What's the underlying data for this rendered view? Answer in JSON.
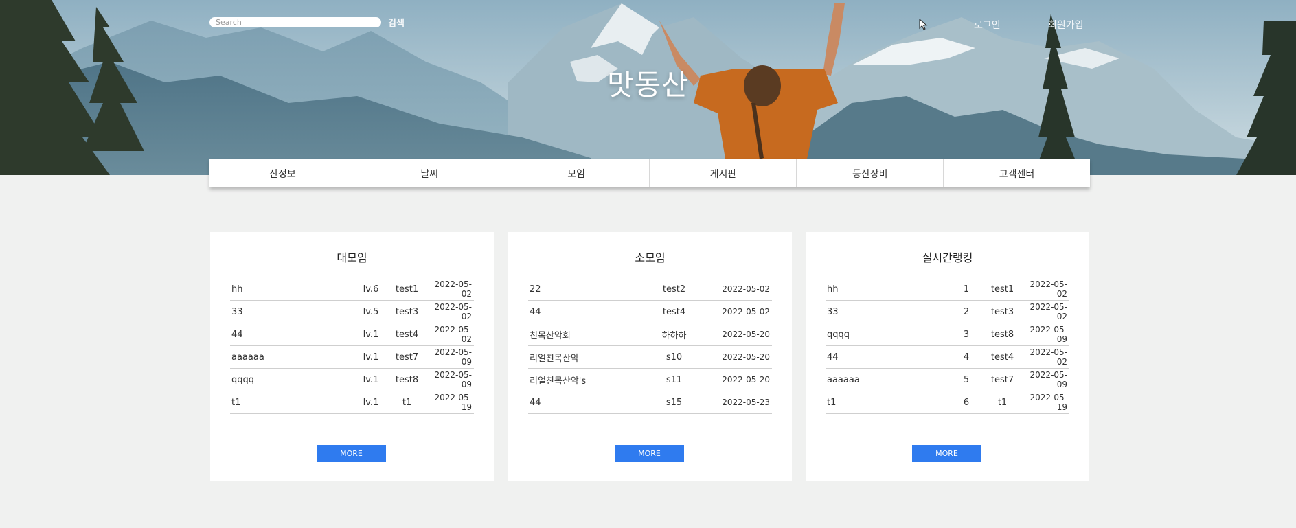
{
  "header": {
    "search_placeholder": "Search",
    "search_button": "검색",
    "login": "로그인",
    "signup": "회원가입",
    "site_title": "맛동산"
  },
  "nav": [
    "산정보",
    "날씨",
    "모임",
    "게시판",
    "등산장비",
    "고객센터"
  ],
  "colors": {
    "accent": "#2f7bef",
    "background": "#f0f1f0",
    "panel": "#ffffff"
  },
  "boards": [
    {
      "title": "대모임",
      "more": "MORE",
      "rows": [
        {
          "title": "hh",
          "mid": "lv.6",
          "user": "test1",
          "date": "2022-05-02"
        },
        {
          "title": "33",
          "mid": "lv.5",
          "user": "test3",
          "date": "2022-05-02"
        },
        {
          "title": "44",
          "mid": "lv.1",
          "user": "test4",
          "date": "2022-05-02"
        },
        {
          "title": "aaaaaa",
          "mid": "lv.1",
          "user": "test7",
          "date": "2022-05-09"
        },
        {
          "title": "qqqq",
          "mid": "lv.1",
          "user": "test8",
          "date": "2022-05-09"
        },
        {
          "title": "t1",
          "mid": "lv.1",
          "user": "t1",
          "date": "2022-05-19"
        }
      ]
    },
    {
      "title": "소모임",
      "more": "MORE",
      "rows": [
        {
          "title": "22",
          "mid": "",
          "user": "test2",
          "date": "2022-05-02"
        },
        {
          "title": "44",
          "mid": "",
          "user": "test4",
          "date": "2022-05-02"
        },
        {
          "title": "친목산악회",
          "mid": "",
          "user": "하하하",
          "date": "2022-05-20"
        },
        {
          "title": "리얼친목산악",
          "mid": "",
          "user": "s10",
          "date": "2022-05-20"
        },
        {
          "title": "리얼친목산악's",
          "mid": "",
          "user": "s11",
          "date": "2022-05-20"
        },
        {
          "title": "44",
          "mid": "",
          "user": "s15",
          "date": "2022-05-23"
        }
      ]
    },
    {
      "title": "실시간랭킹",
      "more": "MORE",
      "rows": [
        {
          "title": "hh",
          "mid": "1",
          "user": "test1",
          "date": "2022-05-02"
        },
        {
          "title": "33",
          "mid": "2",
          "user": "test3",
          "date": "2022-05-02"
        },
        {
          "title": "qqqq",
          "mid": "3",
          "user": "test8",
          "date": "2022-05-09"
        },
        {
          "title": "44",
          "mid": "4",
          "user": "test4",
          "date": "2022-05-02"
        },
        {
          "title": "aaaaaa",
          "mid": "5",
          "user": "test7",
          "date": "2022-05-09"
        },
        {
          "title": "t1",
          "mid": "6",
          "user": "t1",
          "date": "2022-05-19"
        }
      ]
    }
  ]
}
